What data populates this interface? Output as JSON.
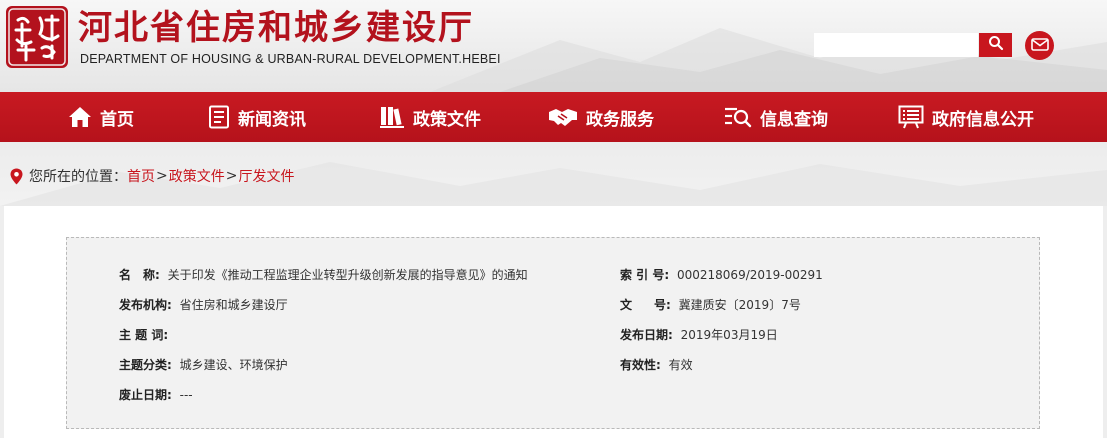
{
  "header": {
    "seal_text": "建设通",
    "title": "河北省住房和城乡建设厅",
    "subtitle": "DEPARTMENT OF HOUSING & URBAN-RURAL DEVELOPMENT.HEBEI",
    "search": {
      "placeholder": "",
      "value": ""
    },
    "search_icon": "search-icon",
    "mail_icon": "mail-icon"
  },
  "nav": {
    "items": [
      {
        "label": "首页",
        "icon": "home-icon"
      },
      {
        "label": "新闻资讯",
        "icon": "document-icon"
      },
      {
        "label": "政策文件",
        "icon": "files-icon"
      },
      {
        "label": "政务服务",
        "icon": "handshake-icon"
      },
      {
        "label": "信息查询",
        "icon": "search-list-icon"
      },
      {
        "label": "政府信息公开",
        "icon": "notice-board-icon"
      }
    ]
  },
  "breadcrumb": {
    "prefix": "您所在的位置：",
    "items": [
      "首页",
      "政策文件",
      "厅发文件"
    ],
    "separator": ">"
  },
  "document": {
    "name_label": "名称",
    "name_value": "关于印发《推动工程监理企业转型升级创新发展的指导意见》的通知",
    "index_label": "索 引 号:",
    "index_value": "000218069/2019-00291",
    "org_label": "发布机构:",
    "org_value": "省住房和城乡建设厅",
    "doc_no_label": "文号",
    "doc_no_value": "冀建质安〔2019〕7号",
    "keywords_label": "主 题 词:",
    "keywords_value": "",
    "date_label": "发布日期:",
    "date_value": "2019年03月19日",
    "category_label": "主题分类:",
    "category_value": "城乡建设、环境保护",
    "validity_label": "有效性:",
    "validity_value": "有效",
    "expiry_label": "废止日期:",
    "expiry_value": "---"
  },
  "colors": {
    "brand_red": "#c8161e",
    "nav_red": "#b5121b",
    "link_red": "#c8161e"
  }
}
